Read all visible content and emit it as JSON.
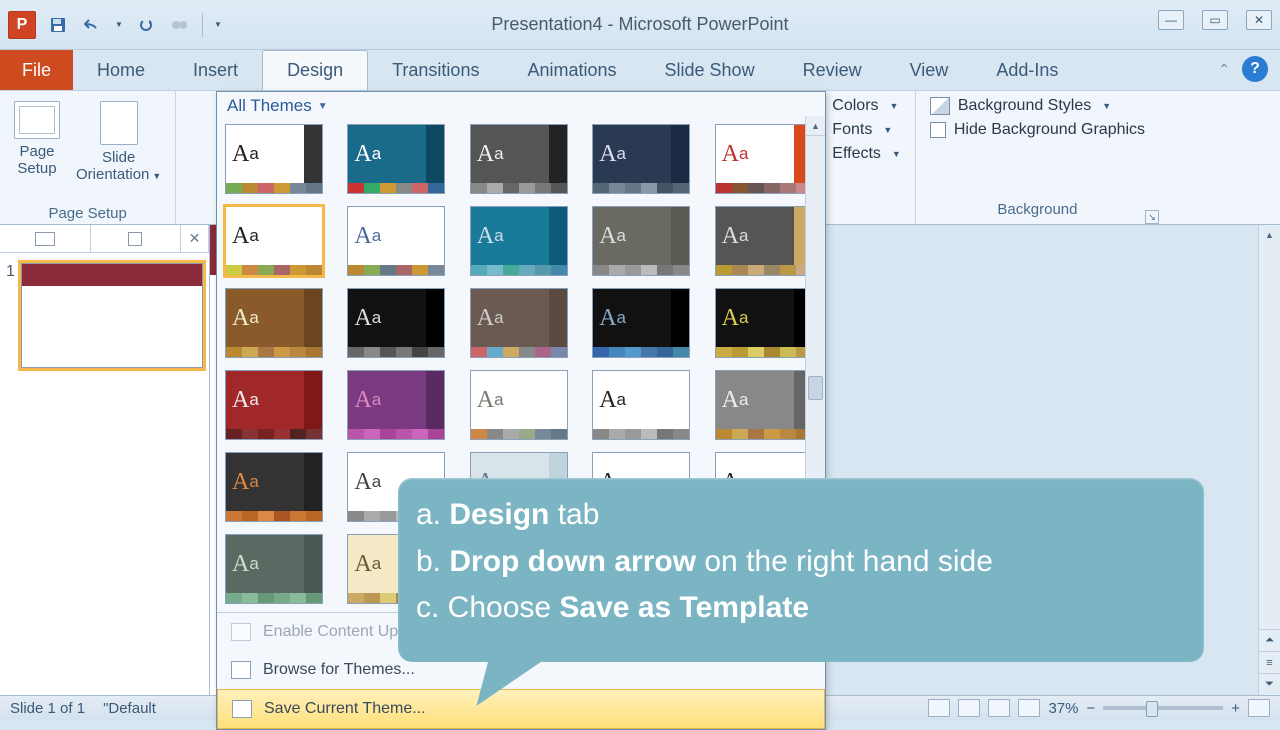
{
  "titlebar": {
    "title": "Presentation4  -  Microsoft PowerPoint"
  },
  "tabs": {
    "file": "File",
    "items": [
      "Home",
      "Insert",
      "Design",
      "Transitions",
      "Animations",
      "Slide Show",
      "Review",
      "View",
      "Add-Ins"
    ],
    "active": "Design"
  },
  "ribbon": {
    "page_setup_group": "Page Setup",
    "page_setup": "Page\nSetup",
    "slide_orientation": "Slide\nOrientation",
    "themes_header": "All Themes",
    "colors": "Colors",
    "fonts": "Fonts",
    "effects": "Effects",
    "bg_styles": "Background Styles",
    "hide_bg": "Hide Background Graphics",
    "background_group": "Background"
  },
  "gallery_menu": {
    "enable": "Enable Content Updates…",
    "browse": "Browse for Themes...",
    "save": "Save Current Theme..."
  },
  "panel": {
    "slide_number": "1"
  },
  "statusbar": {
    "slide": "Slide 1 of 1",
    "theme": "\"Default",
    "zoom": "37%"
  },
  "callout": {
    "a_pre": "a. ",
    "a_b": "Design",
    "a_post": " tab",
    "b_pre": "b. ",
    "b_b": "Drop down arrow",
    "b_post": " on the right hand side",
    "c_pre": "c. Choose ",
    "c_b": "Save as Template"
  },
  "themes": [
    {
      "id": "t1",
      "bg": "#fff",
      "fg": "#222",
      "accent": "#333",
      "strip": [
        "#7a5",
        "#b83",
        "#c66",
        "#c93",
        "#789",
        "#678"
      ]
    },
    {
      "id": "t2",
      "bg": "#1a6a8a",
      "fg": "#fff",
      "accent": "#0d4a62",
      "strip": [
        "#c33",
        "#3a6",
        "#c93",
        "#888",
        "#c66",
        "#369"
      ]
    },
    {
      "id": "t3",
      "bg": "#555",
      "fg": "#eee",
      "accent": "#222",
      "strip": [
        "#888",
        "#aaa",
        "#666",
        "#999",
        "#777",
        "#555"
      ]
    },
    {
      "id": "t4",
      "bg": "#2a3a52",
      "fg": "#dde",
      "accent": "#1a2a42",
      "strip": [
        "#567",
        "#789",
        "#678",
        "#89a",
        "#456",
        "#567"
      ]
    },
    {
      "id": "t5",
      "bg": "#fff",
      "fg": "#b33",
      "accent": "#d84a1a",
      "strip": [
        "#b33",
        "#853",
        "#655",
        "#866",
        "#a77",
        "#c88"
      ]
    },
    {
      "id": "t6",
      "bg": "#fff",
      "fg": "#222",
      "accent": "#fff",
      "strip": [
        "#cc4",
        "#c84",
        "#8a5",
        "#a66",
        "#c93",
        "#b83"
      ],
      "sel": true
    },
    {
      "id": "t7",
      "bg": "#fff",
      "fg": "#4a6a9a",
      "accent": "#fff",
      "strip": [
        "#b83",
        "#8a5",
        "#678",
        "#a66",
        "#c93",
        "#789"
      ]
    },
    {
      "id": "t8",
      "bg": "#1a7a9a",
      "fg": "#cde",
      "accent": "#0d5a7a",
      "strip": [
        "#5ab",
        "#7bc",
        "#4a9",
        "#6ab",
        "#59a",
        "#48a"
      ]
    },
    {
      "id": "t9",
      "bg": "#6a6a62",
      "fg": "#ddd",
      "accent": "#5a5a52",
      "strip": [
        "#888",
        "#aaa",
        "#999",
        "#bbb",
        "#777",
        "#888"
      ]
    },
    {
      "id": "t10",
      "bg": "#555",
      "fg": "#ddd",
      "accent": "#ca6",
      "strip": [
        "#b93",
        "#a85",
        "#ca7",
        "#986",
        "#b94",
        "#ca8"
      ]
    },
    {
      "id": "t11",
      "bg": "#8a5a2a",
      "fg": "#eec",
      "accent": "#6a4520",
      "strip": [
        "#b83",
        "#ca5",
        "#a74",
        "#c94",
        "#b84",
        "#a73"
      ]
    },
    {
      "id": "t12",
      "bg": "#111",
      "fg": "#ddd",
      "accent": "#000",
      "strip": [
        "#666",
        "#888",
        "#555",
        "#777",
        "#444",
        "#666"
      ]
    },
    {
      "id": "t13",
      "bg": "#6a5a52",
      "fg": "#ccc",
      "accent": "#5a4a42",
      "strip": [
        "#c66",
        "#6ac",
        "#ca6",
        "#888",
        "#a68",
        "#78a"
      ]
    },
    {
      "id": "t14",
      "bg": "#111",
      "fg": "#8ac",
      "accent": "#000",
      "strip": [
        "#36a",
        "#48b",
        "#59c",
        "#47a",
        "#369",
        "#48a"
      ]
    },
    {
      "id": "t15",
      "bg": "#111",
      "fg": "#dc5",
      "accent": "#000",
      "strip": [
        "#ca4",
        "#b93",
        "#dc6",
        "#a83",
        "#cb5",
        "#b94"
      ]
    },
    {
      "id": "t16",
      "bg": "#a02828",
      "fg": "#eee",
      "accent": "#801818",
      "strip": [
        "#622",
        "#833",
        "#722",
        "#933",
        "#522",
        "#733"
      ]
    },
    {
      "id": "t17",
      "bg": "#7a3a82",
      "fg": "#d8b",
      "accent": "#5a2a62",
      "strip": [
        "#b5a",
        "#c6b",
        "#a49",
        "#b5a",
        "#c6b",
        "#a49"
      ]
    },
    {
      "id": "t18",
      "bg": "#fff",
      "fg": "#7a7a72",
      "accent": "#fff",
      "strip": [
        "#c84",
        "#888",
        "#aaa",
        "#9a8",
        "#789",
        "#678"
      ]
    },
    {
      "id": "t19",
      "bg": "#fff",
      "fg": "#222",
      "accent": "#fff",
      "strip": [
        "#888",
        "#aaa",
        "#999",
        "#bbb",
        "#777",
        "#888"
      ]
    },
    {
      "id": "t20",
      "bg": "#888",
      "fg": "#eee",
      "accent": "#666",
      "strip": [
        "#b83",
        "#ca5",
        "#a74",
        "#c94",
        "#b84",
        "#a73"
      ]
    },
    {
      "id": "t21",
      "bg": "#333",
      "fg": "#d84",
      "accent": "#222",
      "strip": [
        "#c73",
        "#b62",
        "#d84",
        "#a52",
        "#c73",
        "#b62"
      ]
    },
    {
      "id": "t22",
      "bg": "#fff",
      "fg": "#444",
      "accent": "#fff",
      "strip": [
        "#888",
        "#aaa",
        "#999",
        "#bbb",
        "#777",
        "#888"
      ]
    },
    {
      "id": "t23",
      "bg": "#d8e4ea",
      "fg": "#5a7a8a",
      "accent": "#c0d4de",
      "strip": [
        "#7a9",
        "#8ab",
        "#6a8",
        "#79a",
        "#68a",
        "#799"
      ]
    },
    {
      "id": "t24",
      "bg": "#fff",
      "fg": "#222",
      "accent": "#fff",
      "strip": [
        "#888",
        "#aaa",
        "#999",
        "#bbb",
        "#777",
        "#888"
      ]
    },
    {
      "id": "t25",
      "bg": "#fff",
      "fg": "#222",
      "accent": "#fff",
      "strip": [
        "#888",
        "#aaa",
        "#999",
        "#bbb",
        "#777",
        "#888"
      ]
    },
    {
      "id": "t26",
      "bg": "#5a6a62",
      "fg": "#cdc",
      "accent": "#4a5a52",
      "strip": [
        "#7a8",
        "#8b9",
        "#697",
        "#7a8",
        "#8b9",
        "#697"
      ]
    },
    {
      "id": "t27",
      "bg": "#f4eac8",
      "fg": "#6a5a32",
      "accent": "#e8dab0",
      "strip": [
        "#ca6",
        "#b95",
        "#dc7",
        "#a85",
        "#cb6",
        "#b95"
      ]
    }
  ]
}
